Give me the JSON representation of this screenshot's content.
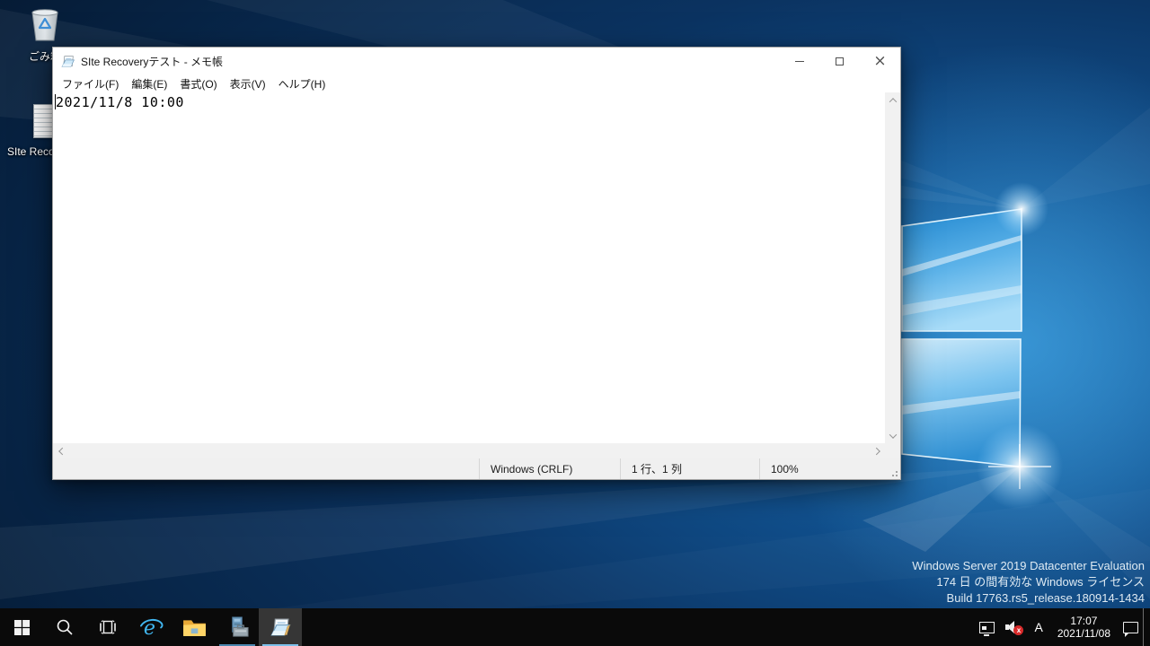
{
  "notepad": {
    "title": "SIte Recoveryテスト - メモ帳",
    "menus": [
      {
        "label": "ファイル(F)"
      },
      {
        "label": "編集(E)"
      },
      {
        "label": "書式(O)"
      },
      {
        "label": "表示(V)"
      },
      {
        "label": "ヘルプ(H)"
      }
    ],
    "content": "2021/11/8 10:00",
    "status": {
      "line_ending": "Windows (CRLF)",
      "cursor_position": "1 行、1 列",
      "zoom": "100%"
    }
  },
  "desktop": {
    "icons": [
      {
        "label": "ごみ箱"
      },
      {
        "label": "SIte Recov"
      }
    ],
    "watermark": [
      "Windows Server 2019 Datacenter Evaluation",
      "174 日 の間有効な Windows ライセンス",
      "Build 17763.rs5_release.180914-1434"
    ]
  },
  "taskbar": {
    "ime_indicator": "A",
    "clock_time": "17:07",
    "clock_date": "2021/11/08",
    "mute_mark": "x"
  },
  "colors": {
    "accent_underline_active": "#7cc0ea",
    "accent_underline_running": "#4a86ad",
    "wallpaper_dark": "#0b2444",
    "wallpaper_glow": "#1d74b8",
    "mute_badge": "#d92b2b"
  }
}
